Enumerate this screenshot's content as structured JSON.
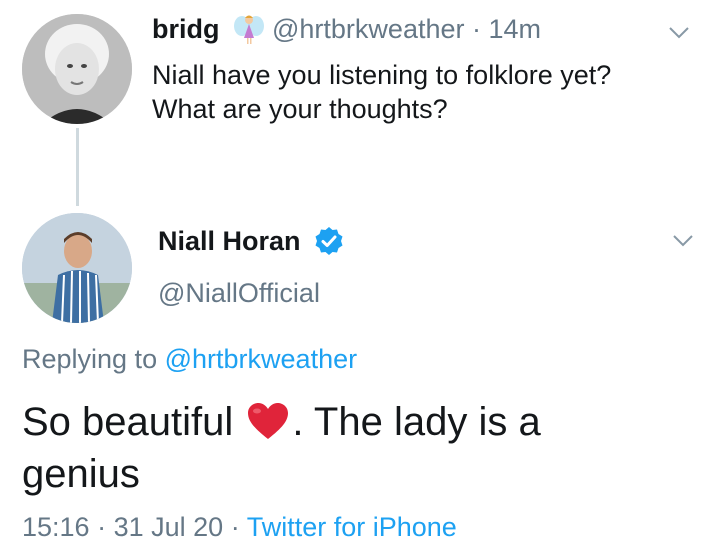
{
  "tweet1": {
    "display_name": "bridg",
    "handle": "@hrtbrkweather",
    "separator": "·",
    "time": "14m",
    "text_line1": "Niall have you listening to folklore yet?",
    "text_line2": "What are your thoughts?",
    "name_emoji": "fairy-icon"
  },
  "tweet2": {
    "display_name": "Niall Horan",
    "handle": "@NiallOfficial",
    "verified": "verified-badge-icon",
    "replying_prefix": "Replying to",
    "replying_handle": "@hrtbrkweather",
    "text_part1": "So beautiful",
    "text_part2": ". The lady is a",
    "text_line2": "genius",
    "time": "15:16",
    "separator1": "·",
    "date": "31 Jul 20",
    "separator2": "·",
    "source": "Twitter for iPhone"
  },
  "colors": {
    "link": "#1da1f2",
    "muted": "#657786",
    "text": "#14171a",
    "heart": "#e0243a"
  }
}
